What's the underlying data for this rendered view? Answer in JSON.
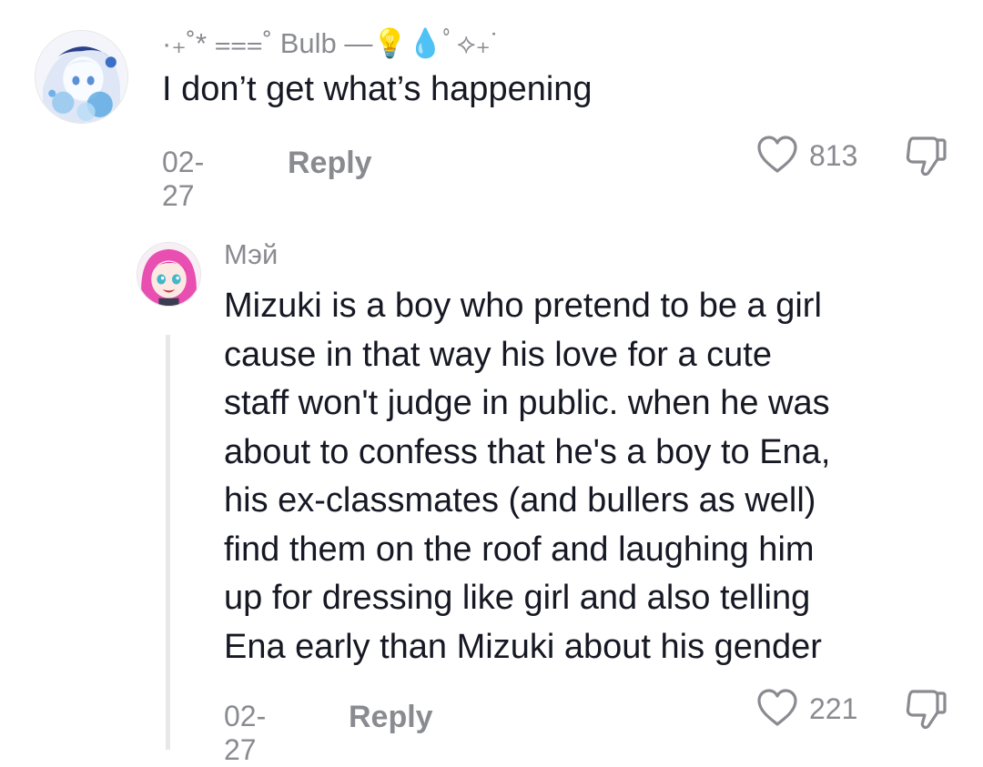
{
  "comments": [
    {
      "username": "·₊˚* ⩶˚ Bulb —💡💧ﾟ⟡₊˙",
      "avatar_icon": "avatar-anime-blue-icon",
      "text": "I don’t get what’s happening",
      "date": "02-27",
      "reply_label": "Reply",
      "likes": "813"
    },
    {
      "username": "Мэй",
      "avatar_icon": "avatar-anime-pink-icon",
      "text_lines": [
        "Mizuki is a boy who pretend to be a girl",
        "cause in that way his love for a cute",
        "staff won't judge in public. when he was",
        "about to confess that he's a boy to Ena,",
        "his ex-classmates (and bullers as well)",
        "find them on the roof and laughing him",
        "up for dressing like girl and also telling",
        "Ena early than Mizuki about his gender"
      ],
      "date": "02-27",
      "reply_label": "Reply",
      "likes": "221"
    }
  ],
  "colors": {
    "text_primary": "#161823",
    "text_secondary": "#8a8b91",
    "thread_line": "#e8e8ea"
  }
}
